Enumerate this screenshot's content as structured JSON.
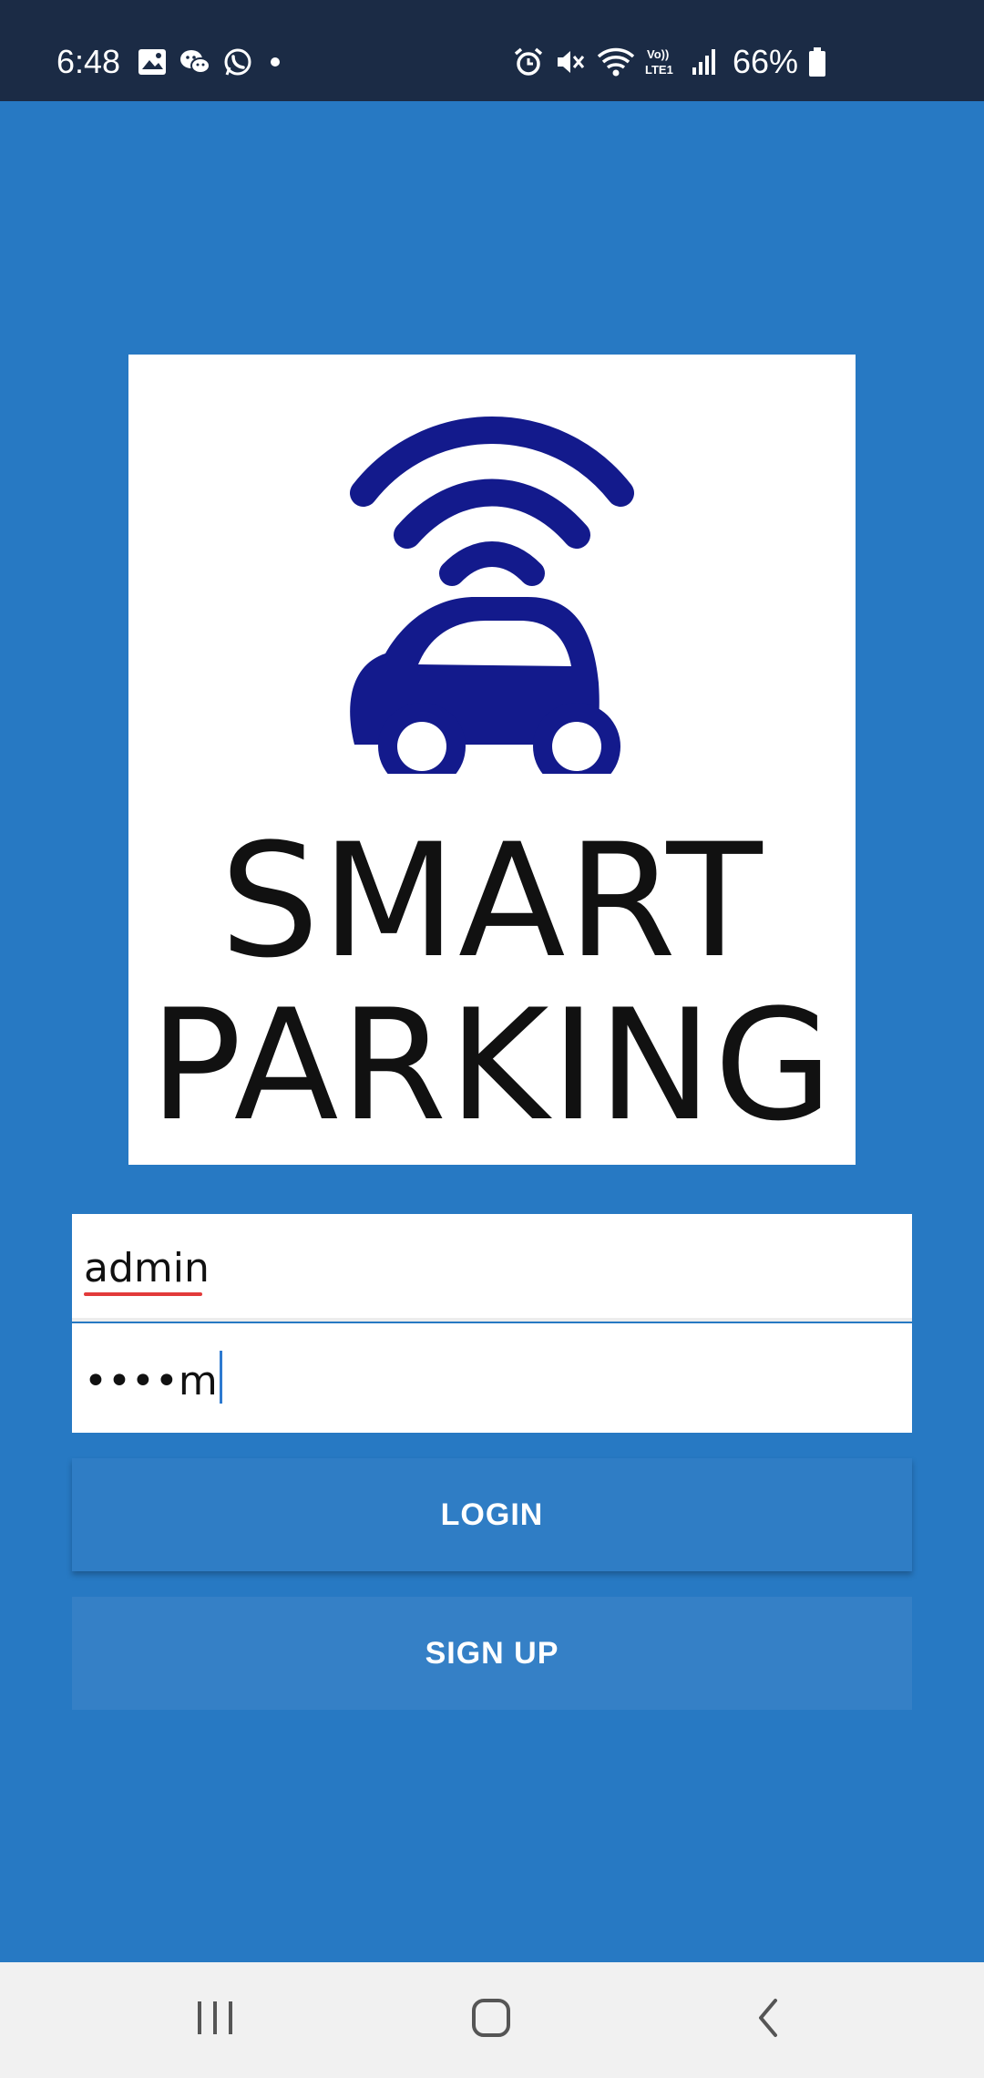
{
  "status_bar": {
    "time": "6:48",
    "battery": "66%",
    "icons_left": [
      "gallery-icon",
      "wechat-icon",
      "whatsapp-icon",
      "dot-icon"
    ],
    "icons_right": [
      "alarm-icon",
      "mute-icon",
      "wifi-icon",
      "volte-icon",
      "signal-icon",
      "battery-icon"
    ]
  },
  "logo": {
    "line1": "SMART",
    "line2": "PARKING",
    "brand_color": "#131a8c"
  },
  "form": {
    "username_value": "admin",
    "password_value": "••••m"
  },
  "buttons": {
    "login": "LOGIN",
    "signup": "SIGN UP"
  },
  "nav_bar": {
    "icons": [
      "recents-icon",
      "home-icon",
      "back-icon"
    ]
  },
  "colors": {
    "background": "#2779c3",
    "status_bar": "#1b2b45",
    "button": "#2f7dc5"
  }
}
